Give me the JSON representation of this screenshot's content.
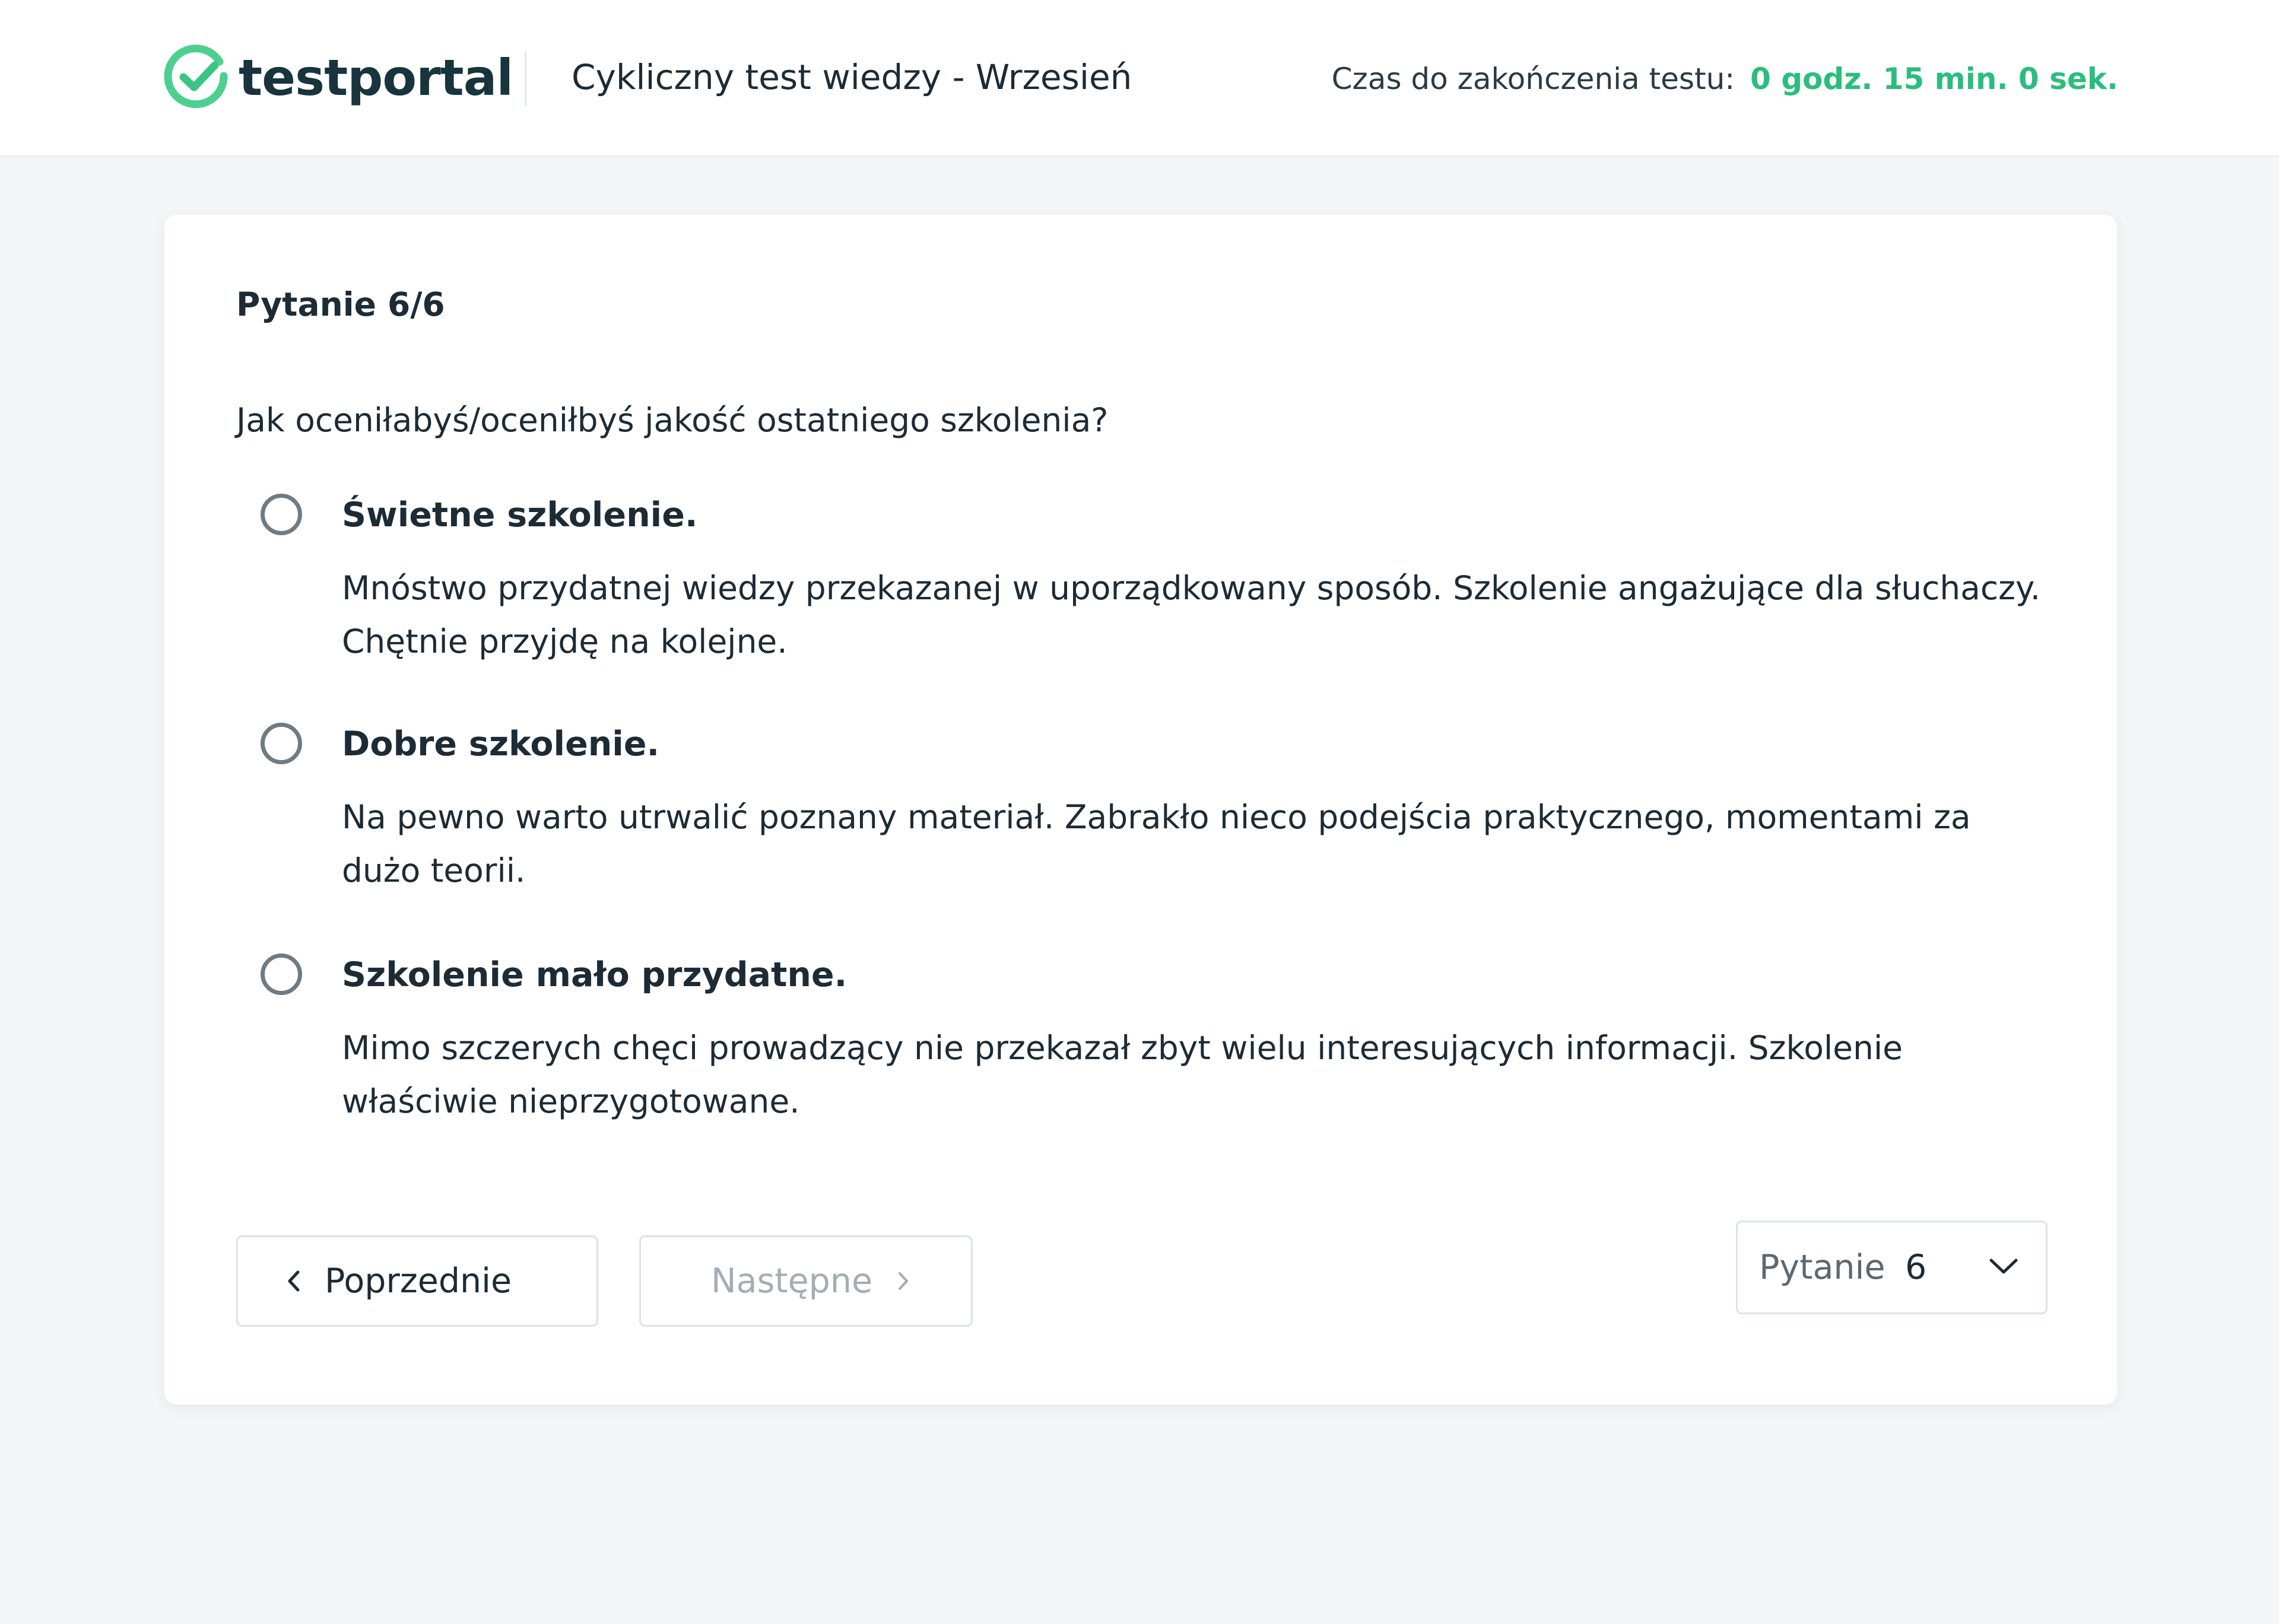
{
  "header": {
    "logo_text": "testportal",
    "test_title": "Cykliczny test wiedzy - Wrzesień",
    "timer_label": "Czas do zakończenia testu:",
    "timer_value": "0 godz. 15 min. 0 sek."
  },
  "question": {
    "number_label": "Pytanie 6/6",
    "text": "Jak oceniłabyś/oceniłbyś jakość ostatniego szkolenia?",
    "options": [
      {
        "title": "Świetne szkolenie.",
        "description": "Mnóstwo przydatnej wiedzy przekazanej w uporządkowany sposób. Szkolenie angażujące dla słuchaczy. Chętnie przyjdę na kolejne.",
        "selected": false
      },
      {
        "title": "Dobre szkolenie.",
        "description": "Na pewno warto utrwalić poznany materiał. Zabrakło nieco podejścia praktycznego, momentami za dużo teorii.",
        "selected": false
      },
      {
        "title": "Szkolenie mało przydatne.",
        "description": "Mimo szczerych chęci prowadzący nie przekazał zbyt wielu interesujących informacji. Szkolenie właściwie nieprzygotowane.",
        "selected": false
      }
    ]
  },
  "navigation": {
    "prev_label": "Poprzednie",
    "next_label": "Następne",
    "next_disabled": true,
    "select_label": "Pytanie",
    "select_value": "6"
  },
  "icons": {
    "logo": "checkmark-circle-icon",
    "prev": "chevron-left-icon",
    "next": "chevron-right-icon",
    "select": "chevron-down-icon"
  },
  "colors": {
    "brand_green": "#2bbd7e",
    "text_dark": "#1c2b36",
    "disabled_text": "#a3adb4",
    "page_background": "#f2f6f6"
  }
}
